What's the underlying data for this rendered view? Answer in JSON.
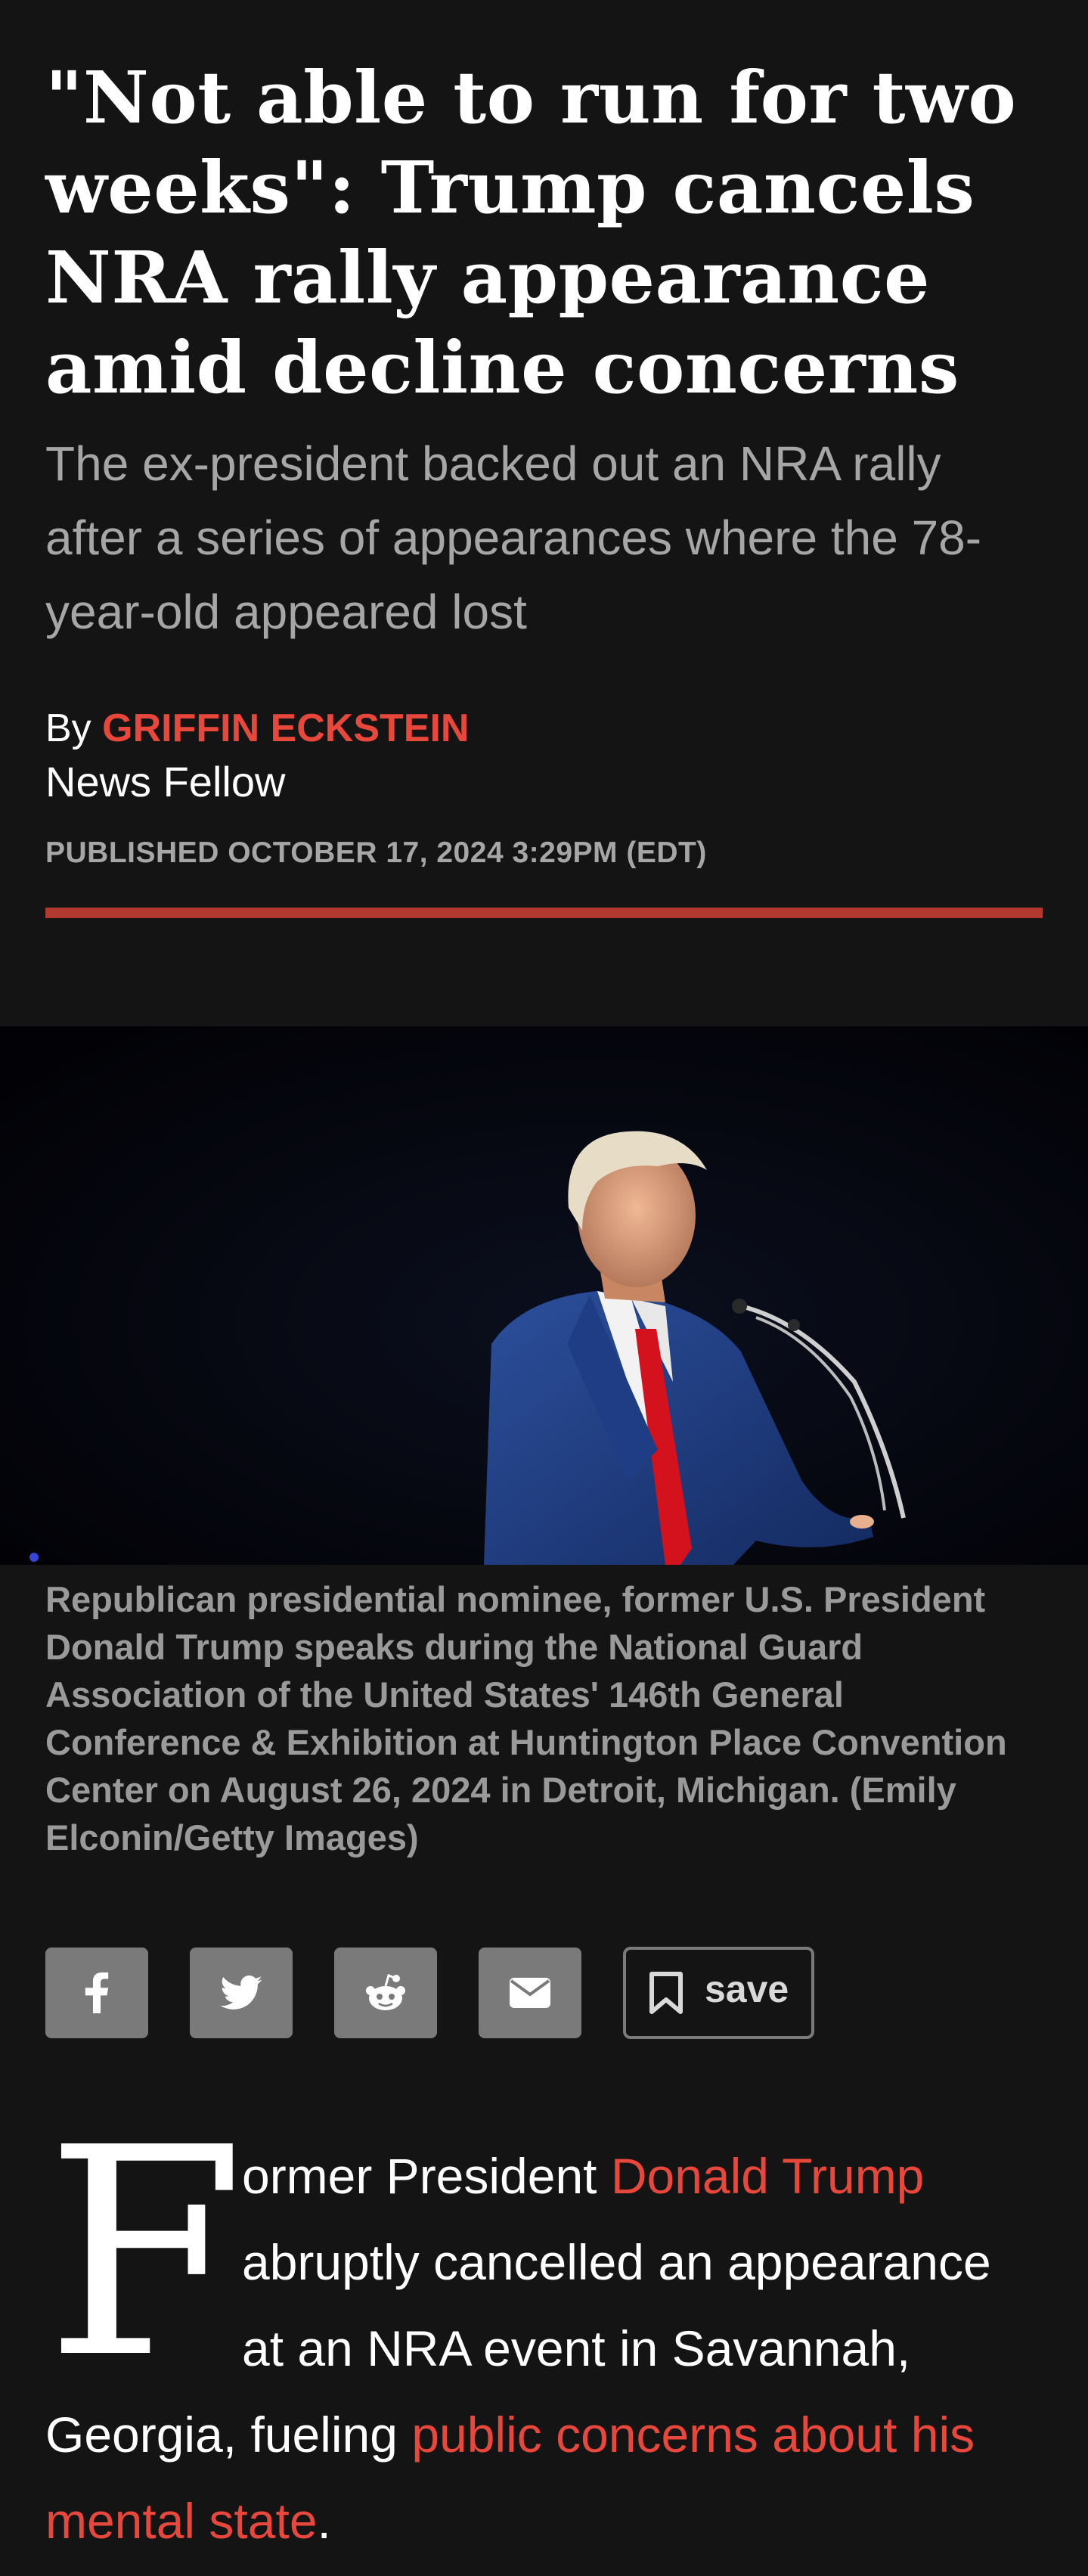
{
  "article": {
    "headline": "\"Not able to run for two weeks\": Trump cancels NRA rally appearance amid decline concerns",
    "subheadline": "The ex-president backed out an NRA rally after a series of appearances where the 78-year-old appeared lost",
    "byline_prefix": "By",
    "author": "GRIFFIN ECKSTEIN",
    "author_role": "News Fellow",
    "published": "PUBLISHED OCTOBER 17, 2024 3:29PM (EDT)",
    "caption": "Republican presidential nominee, former U.S. President Donald Trump speaks during the National Guard Association of the United States' 146th General Conference & Exhibition at Huntington Place Convention Center on August 26, 2024 in Detroit, Michigan. (Emily Elconin/Getty Images)"
  },
  "share": {
    "buttons": [
      {
        "icon": "facebook-icon"
      },
      {
        "icon": "twitter-icon"
      },
      {
        "icon": "reddit-icon"
      },
      {
        "icon": "email-icon"
      }
    ],
    "save_label": "save",
    "save_icon": "bookmark-icon"
  },
  "body": {
    "dropcap": "F",
    "text_1": "ormer President ",
    "link_1": "Donald Trump",
    "text_2": " abruptly cancelled an appearance at an NRA event in Savannah, Georgia, fueling ",
    "link_2": "public concerns about his mental state",
    "text_3": "."
  },
  "colors": {
    "background": "#141414",
    "accent": "#e8473c",
    "rule": "#b2392f",
    "muted": "#a6a6a6",
    "button": "#7a7a7a"
  }
}
